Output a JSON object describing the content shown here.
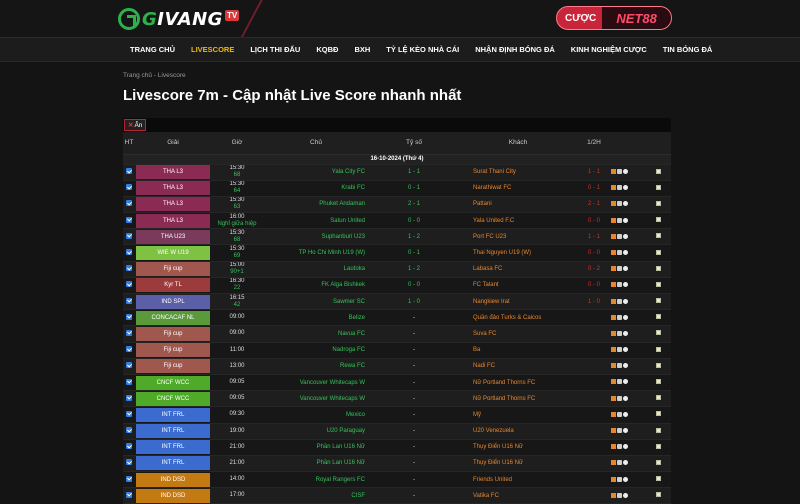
{
  "brand": {
    "prefix": "G",
    "name": "IVANG",
    "suffix": "TV"
  },
  "promo": {
    "left": "CƯỢC",
    "right": "NET88"
  },
  "nav": [
    {
      "label": "TRANG CHỦ",
      "active": false
    },
    {
      "label": "LIVESCORE",
      "active": true
    },
    {
      "label": "LỊCH THI ĐẤU",
      "active": false
    },
    {
      "label": "KQBĐ",
      "active": false
    },
    {
      "label": "BXH",
      "active": false
    },
    {
      "label": "TỶ LỆ KÈO NHÀ CÁI",
      "active": false
    },
    {
      "label": "NHẬN ĐỊNH BÓNG ĐÁ",
      "active": false
    },
    {
      "label": "KINH NGHIỆM CƯỢC",
      "active": false
    },
    {
      "label": "TIN BÓNG ĐÁ",
      "active": false
    }
  ],
  "breadcrumb": "Trang chủ - Livescore",
  "title": "Livescore 7m - Cập nhật Live Score nhanh nhất",
  "toolbar": {
    "hide_label": "Ẩn"
  },
  "table": {
    "headers": [
      "HT",
      "Giải",
      "Giờ",
      "Chủ",
      "Tỷ số",
      "Khách",
      "1/2H",
      "",
      ""
    ],
    "date": "16-10-2024 (Thứ 4)",
    "rows": [
      {
        "league": "THA L3",
        "lc": "#8b2a52",
        "time": "15:30",
        "live": "68",
        "home": "Yala City FC",
        "score": "1 - 1",
        "away": "Surat Thani City",
        "half": "1 - 1"
      },
      {
        "league": "THA L3",
        "lc": "#8b2a52",
        "time": "15:30",
        "live": "64",
        "home": "Krabi FC",
        "score": "0 - 1",
        "away": "Narathiwat FC",
        "half": "0 - 1"
      },
      {
        "league": "THA L3",
        "lc": "#8b2a52",
        "time": "15:30",
        "live": "63",
        "home": "Phuket Andaman",
        "score": "2 - 1",
        "away": "Pattani",
        "half": "2 - 1"
      },
      {
        "league": "THA L3",
        "lc": "#8b2a52",
        "time": "16:00",
        "live": "Nghỉ giữa hiệp",
        "home": "Satun United",
        "score": "0 - 0",
        "away": "Yala United F.C",
        "half": "0 - 0"
      },
      {
        "league": "THA U23",
        "lc": "#7a3a5c",
        "time": "15:30",
        "live": "68",
        "home": "Suphanburi U23",
        "score": "1 - 2",
        "away": "Port FC U23",
        "half": "1 - 1"
      },
      {
        "league": "WIE W U19",
        "lc": "#7dc242",
        "time": "15:30",
        "live": "69",
        "home": "TP Ho Chi Minh U19 (W)",
        "score": "0 - 1",
        "away": "Thai Nguyen U19 (W)",
        "half": "0 - 0"
      },
      {
        "league": "Fiji cup",
        "lc": "#a0584e",
        "time": "15:00",
        "live": "90+1",
        "home": "Lautoka",
        "score": "1 - 2",
        "away": "Labasa FC",
        "half": "0 - 2"
      },
      {
        "league": "Kyr TL",
        "lc": "#9c3b3b",
        "time": "16:30",
        "live": "22",
        "home": "FK Alga Bishkek",
        "score": "0 - 0",
        "away": "FC Talant",
        "half": "0 - 0"
      },
      {
        "league": "IND SPL",
        "lc": "#5b5fa8",
        "time": "16:15",
        "live": "42",
        "home": "Sawmer SC",
        "score": "1 - 0",
        "away": "Nangkiew Irat",
        "half": "1 - 0"
      },
      {
        "league": "CONCACAF NL",
        "lc": "#5a9a3a",
        "time": "09:00",
        "live": "",
        "home": "Belize",
        "score": "-",
        "away": "Quần đảo Turks & Caicos",
        "half": ""
      },
      {
        "league": "Fiji cup",
        "lc": "#a0584e",
        "time": "09:00",
        "live": "",
        "home": "Navua FC",
        "score": "-",
        "away": "Suva FC",
        "half": ""
      },
      {
        "league": "Fiji cup",
        "lc": "#a0584e",
        "time": "11:00",
        "live": "",
        "home": "Nadroga FC",
        "score": "-",
        "away": "Ba",
        "half": ""
      },
      {
        "league": "Fiji cup",
        "lc": "#a0584e",
        "time": "13:00",
        "live": "",
        "home": "Rewa FC",
        "score": "-",
        "away": "Nadi FC",
        "half": ""
      },
      {
        "league": "CNCF WCC",
        "lc": "#4faa2a",
        "time": "09:05",
        "live": "",
        "home": "Vancouver Whitecaps W",
        "score": "-",
        "away": "Nữ Portland Thorns FC",
        "half": ""
      },
      {
        "league": "CNCF WCC",
        "lc": "#4faa2a",
        "time": "09:05",
        "live": "",
        "home": "Vancouver Whitecaps W",
        "score": "-",
        "away": "Nữ Portland Thorns FC",
        "half": ""
      },
      {
        "league": "INT FRL",
        "lc": "#3c6bd0",
        "time": "09:30",
        "live": "",
        "home": "Mexico",
        "score": "-",
        "away": "Mỹ",
        "half": ""
      },
      {
        "league": "INT FRL",
        "lc": "#3c6bd0",
        "time": "19:00",
        "live": "",
        "home": "U20 Paraguay",
        "score": "-",
        "away": "U20 Venezuela",
        "half": ""
      },
      {
        "league": "INT FRL",
        "lc": "#3c6bd0",
        "time": "21:00",
        "live": "",
        "home": "Phần Lan U16 Nữ",
        "score": "-",
        "away": "Thụy Điển U16 Nữ",
        "half": ""
      },
      {
        "league": "INT FRL",
        "lc": "#3c6bd0",
        "time": "21:00",
        "live": "",
        "home": "Phần Lan U16 Nữ",
        "score": "-",
        "away": "Thụy Điển U16 Nữ",
        "half": ""
      },
      {
        "league": "IND DSD",
        "lc": "#c47a12",
        "time": "14:00",
        "live": "",
        "home": "Royal Rangers FC",
        "score": "-",
        "away": "Friends United",
        "half": ""
      },
      {
        "league": "IND DSD",
        "lc": "#c47a12",
        "time": "17:00",
        "live": "",
        "home": "CISF",
        "score": "-",
        "away": "Vatika FC",
        "half": ""
      }
    ]
  },
  "colors": {
    "accent": "#f2b705",
    "live": "#35c25a",
    "halftime": "#c0392b",
    "brand_green": "#2bb24c",
    "promo": "#c8243a"
  }
}
